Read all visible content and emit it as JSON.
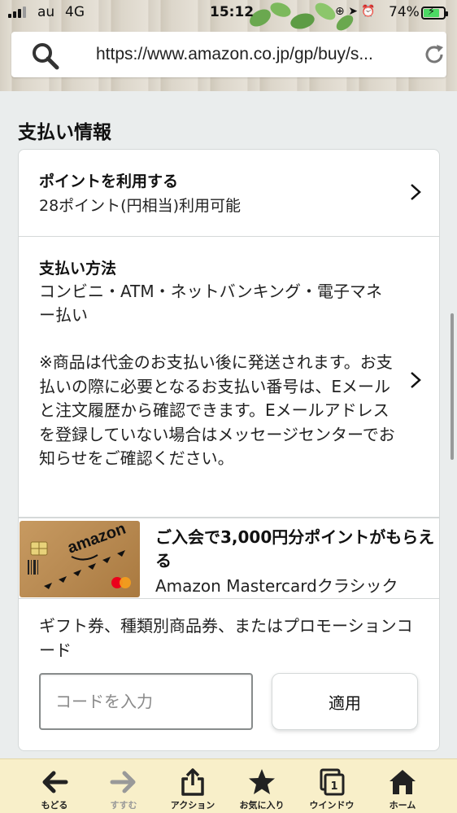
{
  "status_bar": {
    "carrier": "au",
    "network": "4G",
    "time": "15:12",
    "battery": "74%",
    "icons": [
      "signal-icon",
      "orientation-lock-icon",
      "location-icon",
      "alarm-icon",
      "battery-icon"
    ]
  },
  "browser": {
    "url": "https://www.amazon.co.jp/gp/buy/s..."
  },
  "page": {
    "section_title": "支払い情報",
    "points": {
      "title": "ポイントを利用する",
      "subtitle": "28ポイント(円相当)利用可能"
    },
    "payment_method": {
      "title": "支払い方法",
      "description": "コンビニ・ATM・ネットバンキング・電子マネー払い",
      "note": "※商品は代金のお支払い後に発送されます。お支払いの際に必要となるお支払い番号は、Eメールと注文履歴から確認できます。Eメールアドレスを登録していない場合はメッセージセンターでお知らせをご確認ください。"
    },
    "promo": {
      "headline": "ご入会で3,000円分ポイントがもらえる",
      "card_name": "Amazon Mastercardクラシック",
      "card_brand": "amazon",
      "card_network": "mastercard"
    },
    "gift": {
      "label": "ギフト券、種類別商品券、またはプロモーションコード",
      "placeholder": "コードを入力",
      "apply_label": "適用"
    }
  },
  "toolbar": {
    "items": [
      {
        "label": "もどる",
        "icon": "back-arrow-icon"
      },
      {
        "label": "すすむ",
        "icon": "forward-arrow-icon"
      },
      {
        "label": "アクション",
        "icon": "share-icon"
      },
      {
        "label": "お気に入り",
        "icon": "star-icon"
      },
      {
        "label": "ウインドウ",
        "icon": "windows-icon"
      },
      {
        "label": "ホーム",
        "icon": "home-icon"
      }
    ],
    "window_count": "1"
  },
  "colors": {
    "toolbar_bg": "#f8efc9",
    "page_bg": "#eaeded",
    "battery_fill": "#4cd964"
  }
}
